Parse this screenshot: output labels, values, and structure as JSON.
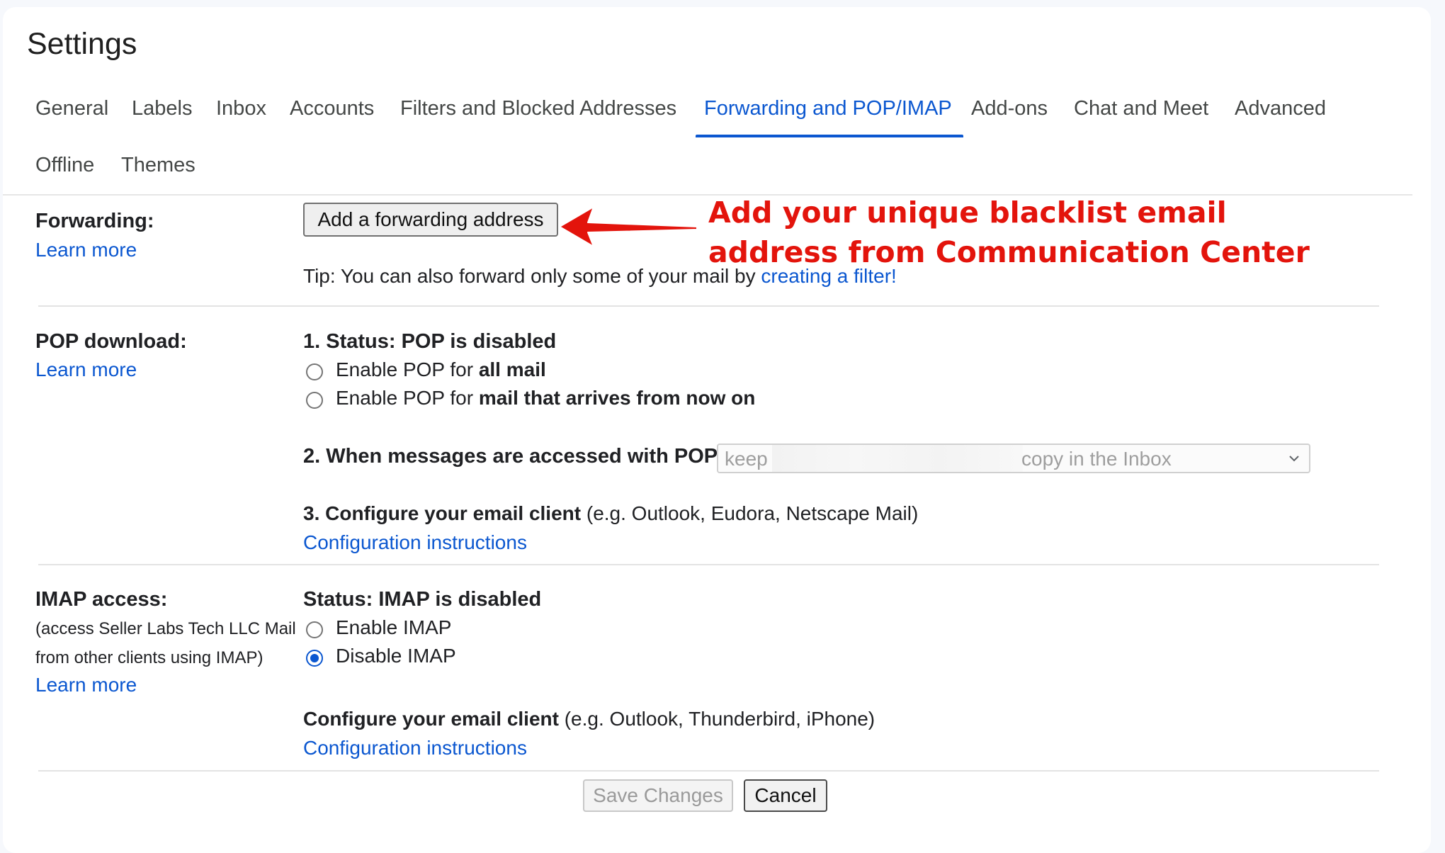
{
  "page": {
    "title": "Settings"
  },
  "tabs": [
    {
      "label": "General",
      "active": false
    },
    {
      "label": "Labels",
      "active": false
    },
    {
      "label": "Inbox",
      "active": false
    },
    {
      "label": "Accounts",
      "active": false
    },
    {
      "label": "Filters and Blocked Addresses",
      "active": false
    },
    {
      "label": "Forwarding and POP/IMAP",
      "active": true
    },
    {
      "label": "Add-ons",
      "active": false
    },
    {
      "label": "Chat and Meet",
      "active": false
    },
    {
      "label": "Advanced",
      "active": false
    },
    {
      "label": "Offline",
      "active": false
    },
    {
      "label": "Themes",
      "active": false
    }
  ],
  "forwarding": {
    "label": "Forwarding:",
    "learn_more": "Learn more",
    "add_button": "Add a forwarding address",
    "tip_prefix": "Tip: You can also forward only some of your mail by ",
    "tip_link": "creating a filter!"
  },
  "annotation": {
    "line1": "Add your unique blacklist email",
    "line2": "address from Communication Center",
    "color": "#e3140c"
  },
  "pop": {
    "label": "POP download:",
    "learn_more": "Learn more",
    "status": "1. Status: POP is disabled",
    "option1_prefix": "Enable POP for ",
    "option1_bold": "all mail",
    "option1_checked": false,
    "option2_prefix": "Enable POP for ",
    "option2_bold": "mail that arrives from now on",
    "option2_checked": false,
    "access_label": "2. When messages are accessed with POP",
    "select_keep": "keep",
    "select_rest": "copy in the Inbox",
    "configure_bold": "3. Configure your email client",
    "configure_rest": " (e.g. Outlook, Eudora, Netscape Mail)",
    "config_link": "Configuration instructions"
  },
  "imap": {
    "label": "IMAP access:",
    "desc_line1": "(access Seller Labs Tech LLC Mail",
    "desc_line2": "from other clients using IMAP)",
    "learn_more": "Learn more",
    "status": "Status: IMAP is disabled",
    "enable_label": "Enable IMAP",
    "enable_checked": false,
    "disable_label": "Disable IMAP",
    "disable_checked": true,
    "configure_bold": "Configure your email client",
    "configure_rest": " (e.g. Outlook, Thunderbird, iPhone)",
    "config_link": "Configuration instructions"
  },
  "footer": {
    "save_label": "Save Changes",
    "cancel_label": "Cancel"
  },
  "colors": {
    "accent": "#0b57d0",
    "annotation": "#e3140c"
  }
}
